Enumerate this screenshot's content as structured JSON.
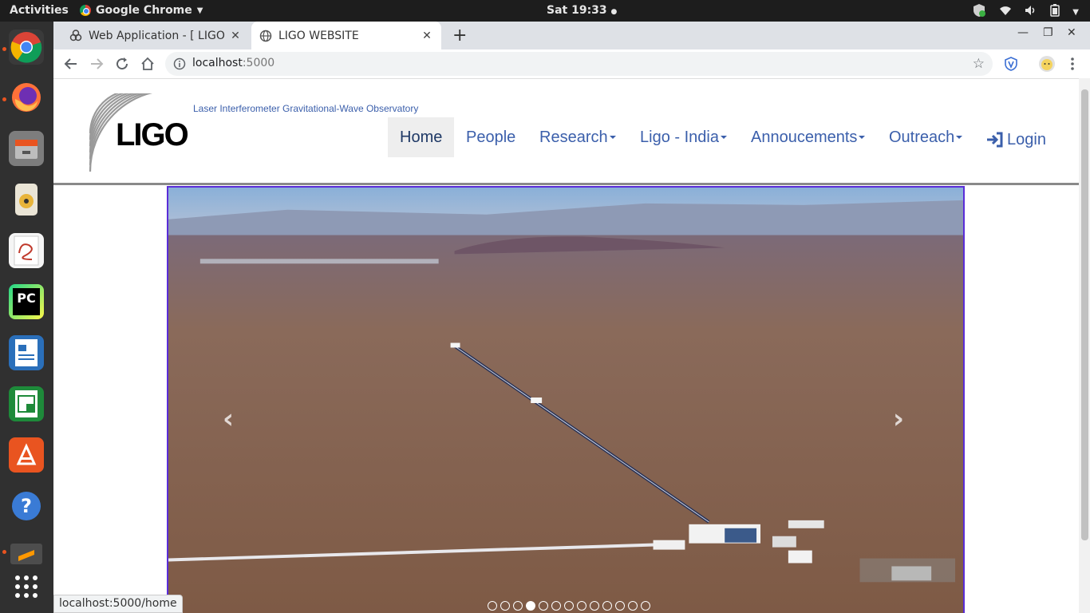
{
  "topbar": {
    "activities": "Activities",
    "app_name": "Google Chrome",
    "clock": "Sat 19:33"
  },
  "dock": {
    "items": [
      {
        "name": "chrome-icon",
        "color": "#4285f4"
      },
      {
        "name": "firefox-icon",
        "color": "#ff7139"
      },
      {
        "name": "files-icon",
        "color": "#8c8c8c"
      },
      {
        "name": "rhythmbox-icon",
        "color": "#e8b43a"
      },
      {
        "name": "document-viewer-icon",
        "color": "#f5f5f5"
      },
      {
        "name": "pycharm-icon",
        "color": "#21d789"
      },
      {
        "name": "writer-icon",
        "color": "#2a6fba"
      },
      {
        "name": "calc-icon",
        "color": "#1e8a3a"
      },
      {
        "name": "software-center-icon",
        "color": "#e95420"
      },
      {
        "name": "help-icon",
        "color": "#3a7bd5"
      },
      {
        "name": "sublime-icon",
        "color": "#4d4d4d"
      },
      {
        "name": "show-apps-icon",
        "color": "#ffffff"
      }
    ]
  },
  "browser": {
    "tabs": [
      {
        "title": "Web Application - [ LIGO ]"
      },
      {
        "title": "LIGO WEBSITE"
      }
    ],
    "url_host": "localhost",
    "url_port": ":5000",
    "status_url": "localhost:5000/home"
  },
  "site": {
    "logo_text": "LIGO",
    "tagline": "Laser Interferometer Gravitational-Wave Observatory",
    "nav": {
      "home": "Home",
      "people": "People",
      "research": "Research",
      "ligo_india": "Ligo - India",
      "announcements": "Annoucements",
      "outreach": "Outreach",
      "login": "Login"
    },
    "carousel": {
      "slide_count": 13,
      "active_index": 3,
      "prev_glyph": "‹",
      "next_glyph": "›"
    }
  },
  "colors": {
    "nav_link": "#3b5fab",
    "carousel_border": "#5a2dd8"
  }
}
